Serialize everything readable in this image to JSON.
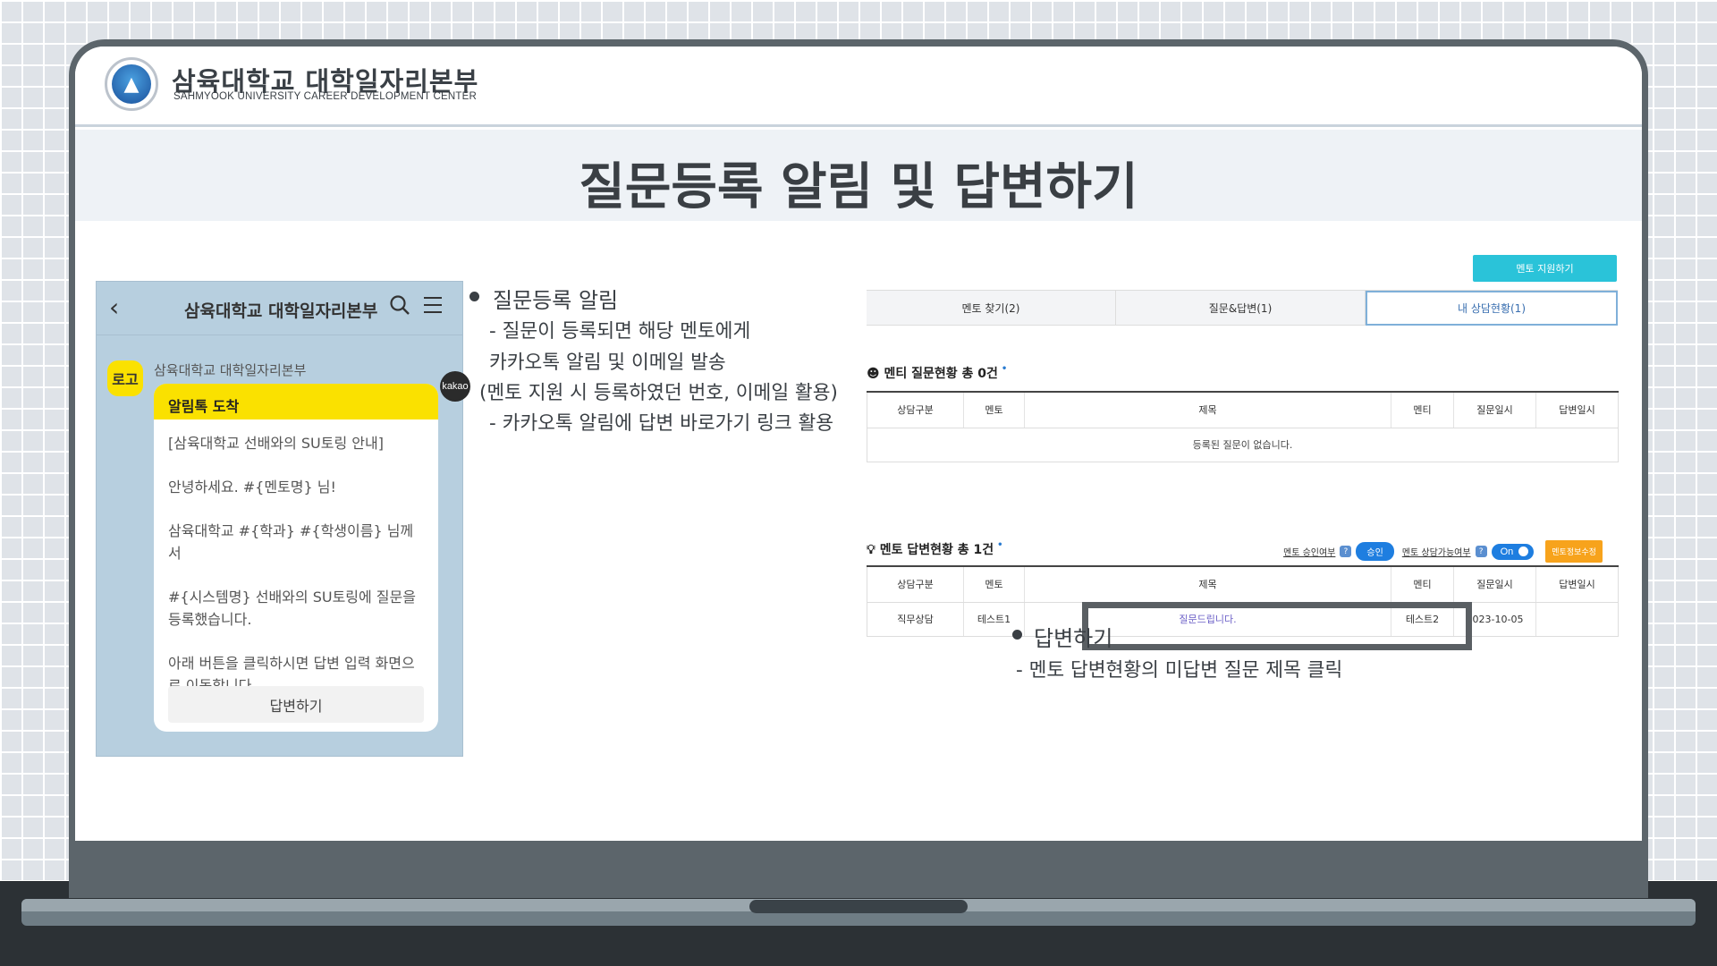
{
  "header": {
    "org_name": "삼육대학교 대학일자리본부",
    "org_name_en": "SAHMYOOK UNIVERSITY CAREER DEVELOPMENT CENTER"
  },
  "page_title": "질문등록 알림 및 답변하기",
  "kakao": {
    "top_title": "삼육대학교 대학일자리본부",
    "avatar_text": "로고",
    "sender": "삼육대학교 대학일자리본부",
    "badge": "kakao",
    "bubble_title": "알림톡 도착",
    "lines": [
      "[삼육대학교 선배와의 SU토링 안내]",
      "안녕하세요. #{멘토명} 님!",
      "삼육대학교 #{학과}  #{학생이름} 님께서",
      "#{시스템명} 선배와의 SU토링에 질문을 등록했습니다.",
      "아래 버튼을 클릭하시면 답변 입력 화면으로 이동합니다."
    ],
    "answer_button": "답변하기"
  },
  "notes": {
    "notify_heading": "질문등록 알림",
    "notify_line1": "- 질문이 등록되면 해당 멘토에게",
    "notify_line2": "카카오톡 알림 및 이메일 발송",
    "notify_line3": "(멘토 지원 시 등록하였던 번호, 이메일 활용)",
    "notify_line4": "- 카카오톡 알림에 답변 바로가기 링크 활용",
    "answer_heading": "답변하기",
    "answer_line1": "- 멘토 답변현황의 미답변 질문 제목 클릭"
  },
  "mentor_page": {
    "apply_button": "멘토 지원하기",
    "tabs": [
      "멘토 찾기(2)",
      "질문&답변(1)",
      "내 상담현황(1)"
    ],
    "mentee_section": {
      "title": "멘티 질문현황 총 0건",
      "columns": [
        "상담구분",
        "멘토",
        "제목",
        "멘티",
        "질문일시",
        "답변일시"
      ],
      "empty_message": "등록된 질문이 없습니다."
    },
    "mentor_section": {
      "title": "멘토 답변현황 총 1건",
      "approval_label": "멘토 승인여부",
      "approval_value": "승인",
      "available_label": "멘토 상담가능여부",
      "available_value": "On",
      "edit_button": "멘토정보수정",
      "columns": [
        "상담구분",
        "멘토",
        "제목",
        "멘티",
        "질문일시",
        "답변일시"
      ],
      "rows": [
        {
          "type": "직무상담",
          "mentor": "테스트1",
          "title": "질문드립니다.",
          "mentee": "테스트2",
          "asked": "2023-10-05",
          "answered": ""
        }
      ]
    }
  }
}
